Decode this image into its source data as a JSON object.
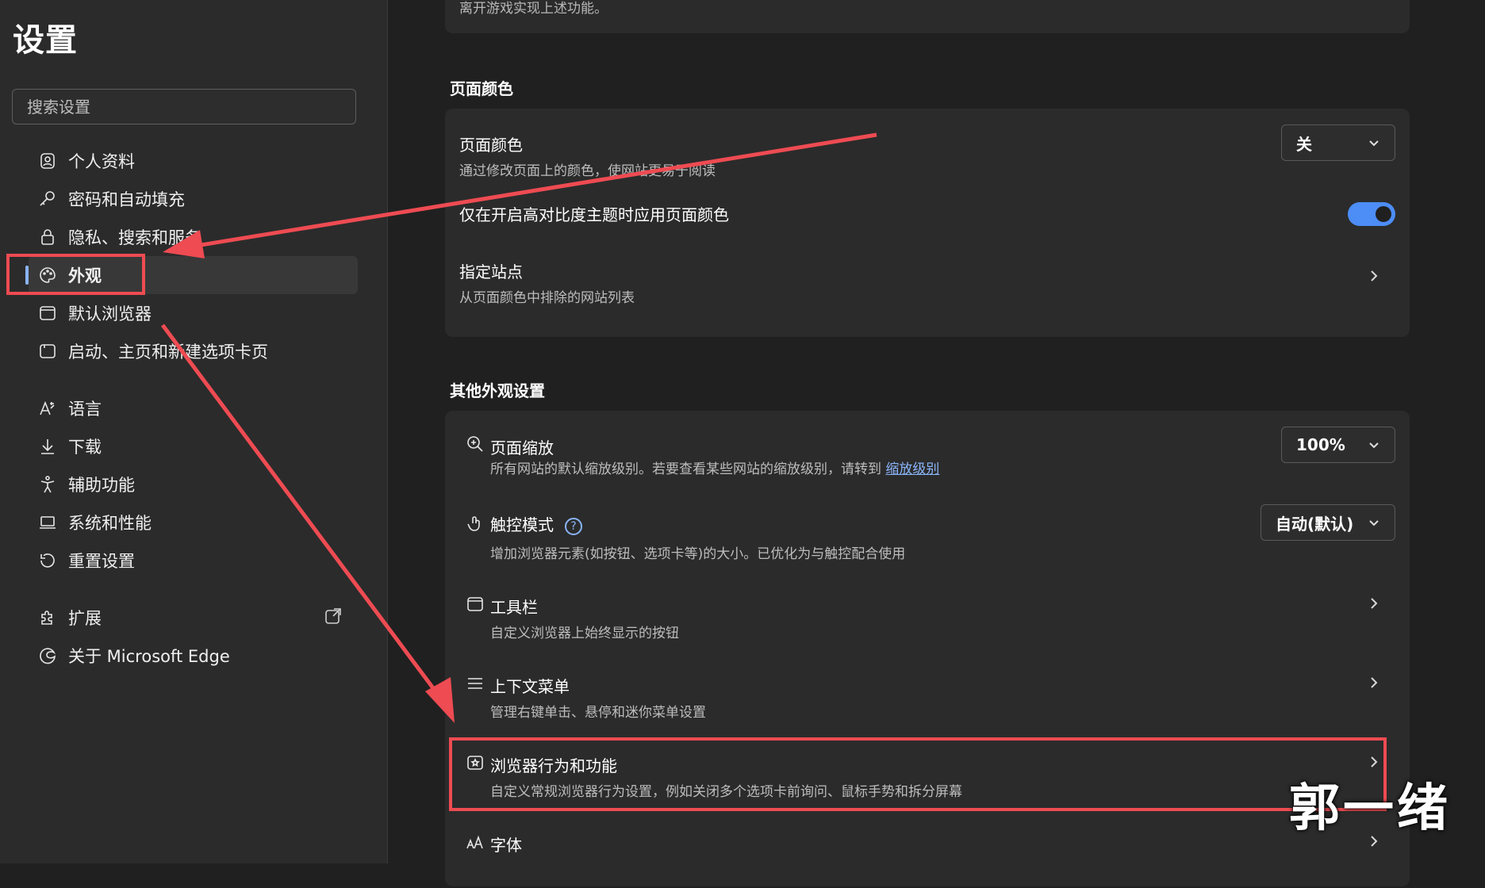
{
  "sidebar": {
    "title": "设置",
    "search_placeholder": "搜索设置",
    "items": [
      {
        "label": "个人资料",
        "icon": "profile-icon"
      },
      {
        "label": "密码和自动填充",
        "icon": "key-icon"
      },
      {
        "label": "隐私、搜索和服务",
        "icon": "lock-icon"
      },
      {
        "label": "外观",
        "icon": "palette-icon",
        "active": true
      },
      {
        "label": "默认浏览器",
        "icon": "browser-icon"
      },
      {
        "label": "启动、主页和新建选项卡页",
        "icon": "home-icon"
      },
      {
        "label": "语言",
        "icon": "language-icon"
      },
      {
        "label": "下载",
        "icon": "download-icon"
      },
      {
        "label": "辅助功能",
        "icon": "accessibility-icon"
      },
      {
        "label": "系统和性能",
        "icon": "laptop-icon"
      },
      {
        "label": "重置设置",
        "icon": "reset-icon"
      },
      {
        "label": "扩展",
        "icon": "extension-icon"
      },
      {
        "label": "关于 Microsoft Edge",
        "icon": "edge-icon"
      }
    ]
  },
  "top_card_text": "离开游戏实现上述功能。",
  "page_color_section": {
    "title": "页面颜色",
    "rows": [
      {
        "title": "页面颜色",
        "subtitle": "通过修改页面上的颜色，使网站更易于阅读",
        "dropdown_value": "关"
      },
      {
        "title": "仅在开启高对比度主题时应用页面颜色",
        "toggle_on": true
      },
      {
        "title": "指定站点",
        "subtitle": "从页面颜色中排除的网站列表"
      }
    ]
  },
  "other_section": {
    "title": "其他外观设置",
    "rows": [
      {
        "title": "页面缩放",
        "subtitle": "所有网站的默认缩放级别。若要查看某些网站的缩放级别，请转到",
        "link": "缩放级别",
        "dropdown_value": "100%",
        "icon": "zoom-icon"
      },
      {
        "title": "触控模式",
        "help": "?",
        "subtitle": "增加浏览器元素(如按钮、选项卡等)的大小。已优化为与触控配合使用",
        "dropdown_value": "自动(默认)",
        "icon": "touch-icon"
      },
      {
        "title": "工具栏",
        "subtitle": "自定义浏览器上始终显示的按钮",
        "icon": "toolbar-icon"
      },
      {
        "title": "上下文菜单",
        "subtitle": "管理右键单击、悬停和迷你菜单设置",
        "icon": "menu-icon"
      },
      {
        "title": "浏览器行为和功能",
        "subtitle": "自定义常规浏览器行为设置，例如关闭多个选项卡前询问、鼠标手势和拆分屏幕",
        "icon": "browser-features-icon"
      },
      {
        "title": "字体",
        "icon": "font-icon"
      }
    ]
  },
  "watermark": "郭一绪",
  "colors": {
    "accent": "#4c8df6",
    "annotation": "#ee4b52",
    "link": "#8ab4f8"
  }
}
